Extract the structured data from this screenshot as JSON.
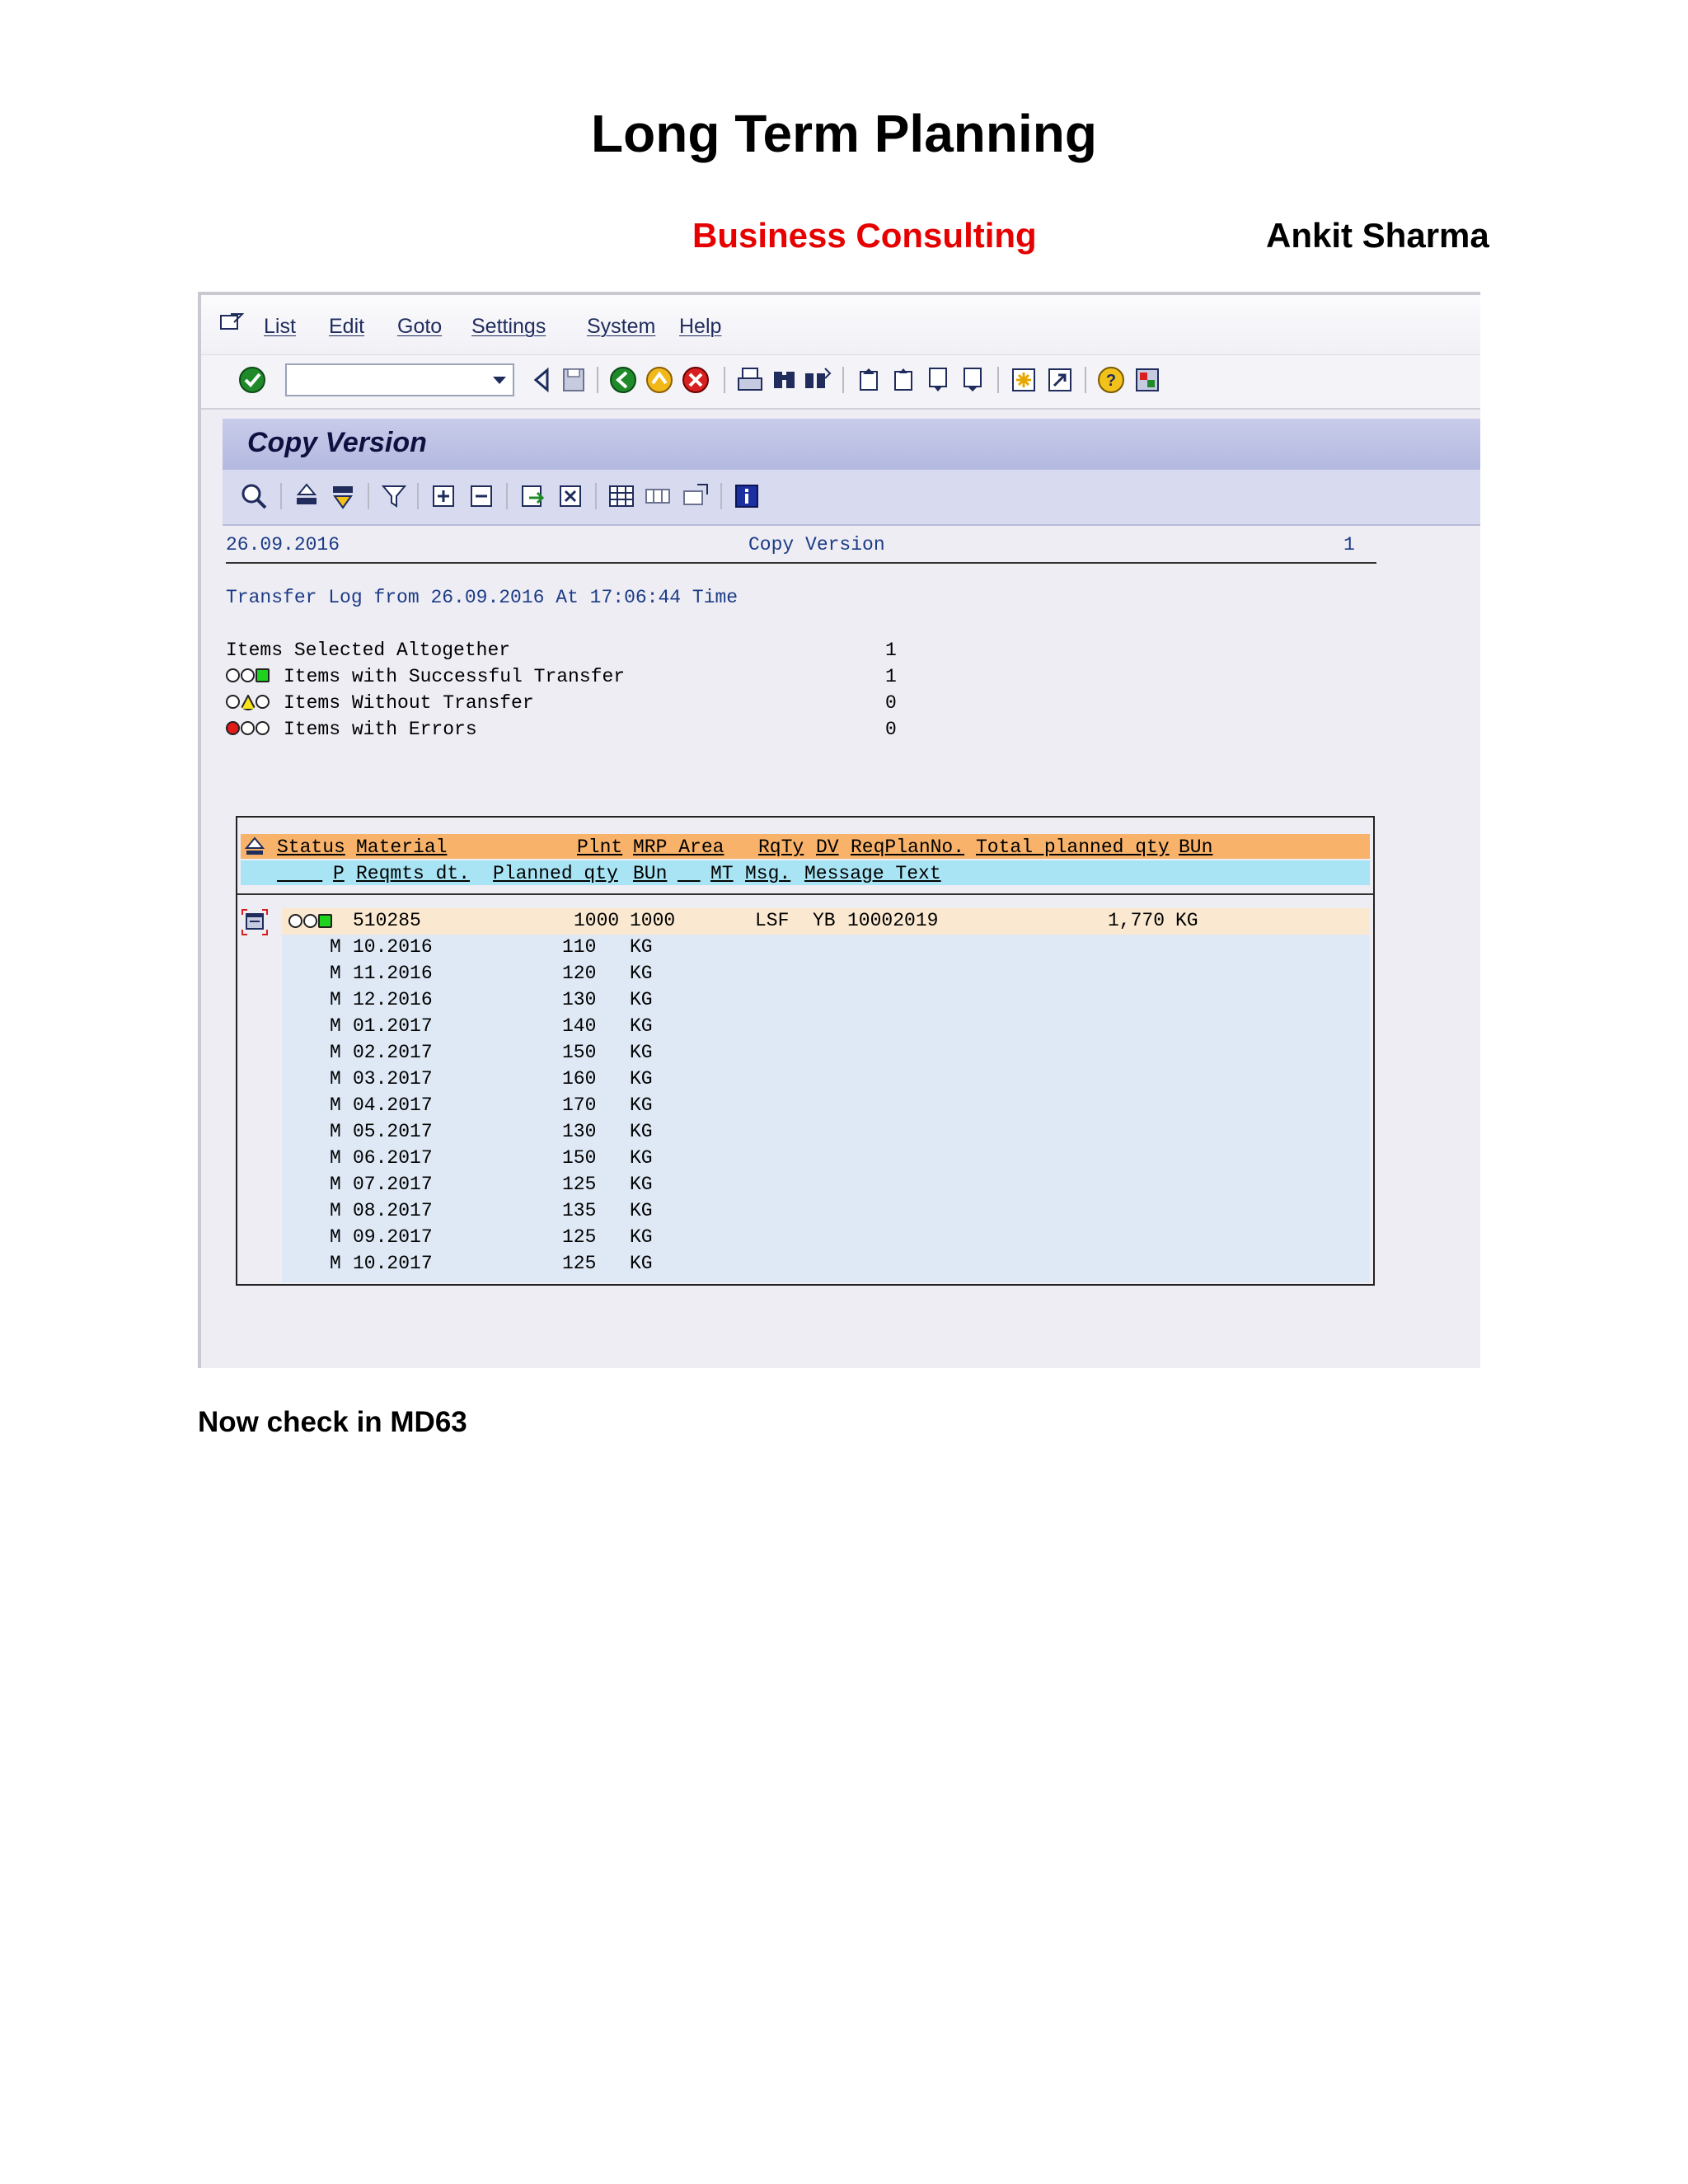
{
  "document": {
    "title": "Long Term Planning",
    "subtitle_red": "Business Consulting",
    "author": "Ankit Sharma",
    "footer_note": "Now check in MD63"
  },
  "menu": {
    "items": [
      "List",
      "Edit",
      "Goto",
      "Settings",
      "System",
      "Help"
    ]
  },
  "toolbar": {
    "command_field_value": ""
  },
  "panel": {
    "title": "Copy Version"
  },
  "report": {
    "date": "26.09.2016",
    "heading": "Copy Version",
    "page": "1",
    "transfer_log": "Transfer Log from 26.09.2016 At 17:06:44 Time",
    "summary": [
      {
        "label": "Items Selected Altogether",
        "value": "1",
        "light": "none"
      },
      {
        "label": "Items with Successful Transfer",
        "value": "1",
        "light": "green"
      },
      {
        "label": "Items Without Transfer",
        "value": "0",
        "light": "yellow"
      },
      {
        "label": "Items with Errors",
        "value": "0",
        "light": "red"
      }
    ]
  },
  "grid": {
    "header1": {
      "status": "Status",
      "material": "Material",
      "plnt": "Plnt",
      "mrp_area": "MRP Area",
      "rqty": "RqTy",
      "dv": "DV",
      "reqplanno": "ReqPlanNo.",
      "total_planned_qty": "Total planned qty",
      "bun": "BUn"
    },
    "header2": {
      "p": "P",
      "reqmts_dt": "Reqmts dt.",
      "planned_qty": "Planned qty",
      "bun": "BUn",
      "mt": "MT",
      "msg": "Msg.",
      "message_text": "Message Text"
    },
    "main_row": {
      "material": "510285",
      "plnt": "1000",
      "mrp_area": "1000",
      "rqty": "LSF",
      "dv": "YB",
      "reqplanno": "10002019",
      "total_planned_qty": "1,770",
      "bun": "KG"
    },
    "sub_rows": [
      {
        "p": "M",
        "date": "10.2016",
        "qty": "110",
        "bun": "KG"
      },
      {
        "p": "M",
        "date": "11.2016",
        "qty": "120",
        "bun": "KG"
      },
      {
        "p": "M",
        "date": "12.2016",
        "qty": "130",
        "bun": "KG"
      },
      {
        "p": "M",
        "date": "01.2017",
        "qty": "140",
        "bun": "KG"
      },
      {
        "p": "M",
        "date": "02.2017",
        "qty": "150",
        "bun": "KG"
      },
      {
        "p": "M",
        "date": "03.2017",
        "qty": "160",
        "bun": "KG"
      },
      {
        "p": "M",
        "date": "04.2017",
        "qty": "170",
        "bun": "KG"
      },
      {
        "p": "M",
        "date": "05.2017",
        "qty": "130",
        "bun": "KG"
      },
      {
        "p": "M",
        "date": "06.2017",
        "qty": "150",
        "bun": "KG"
      },
      {
        "p": "M",
        "date": "07.2017",
        "qty": "125",
        "bun": "KG"
      },
      {
        "p": "M",
        "date": "08.2017",
        "qty": "135",
        "bun": "KG"
      },
      {
        "p": "M",
        "date": "09.2017",
        "qty": "125",
        "bun": "KG"
      },
      {
        "p": "M",
        "date": "10.2017",
        "qty": "125",
        "bun": "KG"
      }
    ]
  },
  "colors": {
    "title_red": "#e60000",
    "report_blue": "#1c3c86",
    "header_orange": "#f8b26a",
    "header_cyan": "#a8e4f4",
    "main_row": "#fae8d0",
    "sub_rows": "#dfe9f5"
  },
  "icons": {
    "menu": "menu-icon",
    "toolbar": [
      "enter-check-icon",
      "back-icon",
      "save-icon",
      "green-back-icon",
      "exit-icon",
      "cancel-icon",
      "print-icon",
      "find-icon",
      "find-next-icon",
      "first-page-icon",
      "previous-page-icon",
      "next-page-icon",
      "last-page-icon",
      "create-session-icon",
      "shortcut-icon",
      "help-icon",
      "layout-icon"
    ],
    "application_toolbar": [
      "details-icon",
      "sort-ascending-icon",
      "sort-descending-icon",
      "filter-icon",
      "expand-icon",
      "collapse-icon",
      "export-icon",
      "delete-icon",
      "table-icon",
      "columns-icon",
      "layout-settings-icon",
      "info-icon"
    ]
  }
}
